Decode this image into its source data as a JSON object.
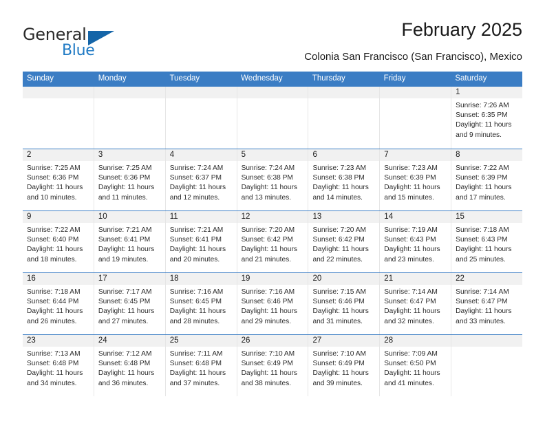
{
  "brand": {
    "name_part1": "General",
    "name_part2": "Blue"
  },
  "header": {
    "title": "February 2025",
    "subtitle": "Colonia San Francisco (San Francisco), Mexico"
  },
  "colors": {
    "header_blue": "#3b7dc4",
    "logo_blue": "#1f7ac4",
    "daynum_band": "#f1f1f1",
    "cell_border": "#e6e6e6"
  },
  "day_headers": [
    "Sunday",
    "Monday",
    "Tuesday",
    "Wednesday",
    "Thursday",
    "Friday",
    "Saturday"
  ],
  "weeks": [
    [
      {
        "empty": true
      },
      {
        "empty": true
      },
      {
        "empty": true
      },
      {
        "empty": true
      },
      {
        "empty": true
      },
      {
        "empty": true
      },
      {
        "day": "1",
        "sunrise": "Sunrise: 7:26 AM",
        "sunset": "Sunset: 6:35 PM",
        "daylight1": "Daylight: 11 hours",
        "daylight2": "and 9 minutes."
      }
    ],
    [
      {
        "day": "2",
        "sunrise": "Sunrise: 7:25 AM",
        "sunset": "Sunset: 6:36 PM",
        "daylight1": "Daylight: 11 hours",
        "daylight2": "and 10 minutes."
      },
      {
        "day": "3",
        "sunrise": "Sunrise: 7:25 AM",
        "sunset": "Sunset: 6:36 PM",
        "daylight1": "Daylight: 11 hours",
        "daylight2": "and 11 minutes."
      },
      {
        "day": "4",
        "sunrise": "Sunrise: 7:24 AM",
        "sunset": "Sunset: 6:37 PM",
        "daylight1": "Daylight: 11 hours",
        "daylight2": "and 12 minutes."
      },
      {
        "day": "5",
        "sunrise": "Sunrise: 7:24 AM",
        "sunset": "Sunset: 6:38 PM",
        "daylight1": "Daylight: 11 hours",
        "daylight2": "and 13 minutes."
      },
      {
        "day": "6",
        "sunrise": "Sunrise: 7:23 AM",
        "sunset": "Sunset: 6:38 PM",
        "daylight1": "Daylight: 11 hours",
        "daylight2": "and 14 minutes."
      },
      {
        "day": "7",
        "sunrise": "Sunrise: 7:23 AM",
        "sunset": "Sunset: 6:39 PM",
        "daylight1": "Daylight: 11 hours",
        "daylight2": "and 15 minutes."
      },
      {
        "day": "8",
        "sunrise": "Sunrise: 7:22 AM",
        "sunset": "Sunset: 6:39 PM",
        "daylight1": "Daylight: 11 hours",
        "daylight2": "and 17 minutes."
      }
    ],
    [
      {
        "day": "9",
        "sunrise": "Sunrise: 7:22 AM",
        "sunset": "Sunset: 6:40 PM",
        "daylight1": "Daylight: 11 hours",
        "daylight2": "and 18 minutes."
      },
      {
        "day": "10",
        "sunrise": "Sunrise: 7:21 AM",
        "sunset": "Sunset: 6:41 PM",
        "daylight1": "Daylight: 11 hours",
        "daylight2": "and 19 minutes."
      },
      {
        "day": "11",
        "sunrise": "Sunrise: 7:21 AM",
        "sunset": "Sunset: 6:41 PM",
        "daylight1": "Daylight: 11 hours",
        "daylight2": "and 20 minutes."
      },
      {
        "day": "12",
        "sunrise": "Sunrise: 7:20 AM",
        "sunset": "Sunset: 6:42 PM",
        "daylight1": "Daylight: 11 hours",
        "daylight2": "and 21 minutes."
      },
      {
        "day": "13",
        "sunrise": "Sunrise: 7:20 AM",
        "sunset": "Sunset: 6:42 PM",
        "daylight1": "Daylight: 11 hours",
        "daylight2": "and 22 minutes."
      },
      {
        "day": "14",
        "sunrise": "Sunrise: 7:19 AM",
        "sunset": "Sunset: 6:43 PM",
        "daylight1": "Daylight: 11 hours",
        "daylight2": "and 23 minutes."
      },
      {
        "day": "15",
        "sunrise": "Sunrise: 7:18 AM",
        "sunset": "Sunset: 6:43 PM",
        "daylight1": "Daylight: 11 hours",
        "daylight2": "and 25 minutes."
      }
    ],
    [
      {
        "day": "16",
        "sunrise": "Sunrise: 7:18 AM",
        "sunset": "Sunset: 6:44 PM",
        "daylight1": "Daylight: 11 hours",
        "daylight2": "and 26 minutes."
      },
      {
        "day": "17",
        "sunrise": "Sunrise: 7:17 AM",
        "sunset": "Sunset: 6:45 PM",
        "daylight1": "Daylight: 11 hours",
        "daylight2": "and 27 minutes."
      },
      {
        "day": "18",
        "sunrise": "Sunrise: 7:16 AM",
        "sunset": "Sunset: 6:45 PM",
        "daylight1": "Daylight: 11 hours",
        "daylight2": "and 28 minutes."
      },
      {
        "day": "19",
        "sunrise": "Sunrise: 7:16 AM",
        "sunset": "Sunset: 6:46 PM",
        "daylight1": "Daylight: 11 hours",
        "daylight2": "and 29 minutes."
      },
      {
        "day": "20",
        "sunrise": "Sunrise: 7:15 AM",
        "sunset": "Sunset: 6:46 PM",
        "daylight1": "Daylight: 11 hours",
        "daylight2": "and 31 minutes."
      },
      {
        "day": "21",
        "sunrise": "Sunrise: 7:14 AM",
        "sunset": "Sunset: 6:47 PM",
        "daylight1": "Daylight: 11 hours",
        "daylight2": "and 32 minutes."
      },
      {
        "day": "22",
        "sunrise": "Sunrise: 7:14 AM",
        "sunset": "Sunset: 6:47 PM",
        "daylight1": "Daylight: 11 hours",
        "daylight2": "and 33 minutes."
      }
    ],
    [
      {
        "day": "23",
        "sunrise": "Sunrise: 7:13 AM",
        "sunset": "Sunset: 6:48 PM",
        "daylight1": "Daylight: 11 hours",
        "daylight2": "and 34 minutes."
      },
      {
        "day": "24",
        "sunrise": "Sunrise: 7:12 AM",
        "sunset": "Sunset: 6:48 PM",
        "daylight1": "Daylight: 11 hours",
        "daylight2": "and 36 minutes."
      },
      {
        "day": "25",
        "sunrise": "Sunrise: 7:11 AM",
        "sunset": "Sunset: 6:48 PM",
        "daylight1": "Daylight: 11 hours",
        "daylight2": "and 37 minutes."
      },
      {
        "day": "26",
        "sunrise": "Sunrise: 7:10 AM",
        "sunset": "Sunset: 6:49 PM",
        "daylight1": "Daylight: 11 hours",
        "daylight2": "and 38 minutes."
      },
      {
        "day": "27",
        "sunrise": "Sunrise: 7:10 AM",
        "sunset": "Sunset: 6:49 PM",
        "daylight1": "Daylight: 11 hours",
        "daylight2": "and 39 minutes."
      },
      {
        "day": "28",
        "sunrise": "Sunrise: 7:09 AM",
        "sunset": "Sunset: 6:50 PM",
        "daylight1": "Daylight: 11 hours",
        "daylight2": "and 41 minutes."
      },
      {
        "empty": true
      }
    ]
  ]
}
